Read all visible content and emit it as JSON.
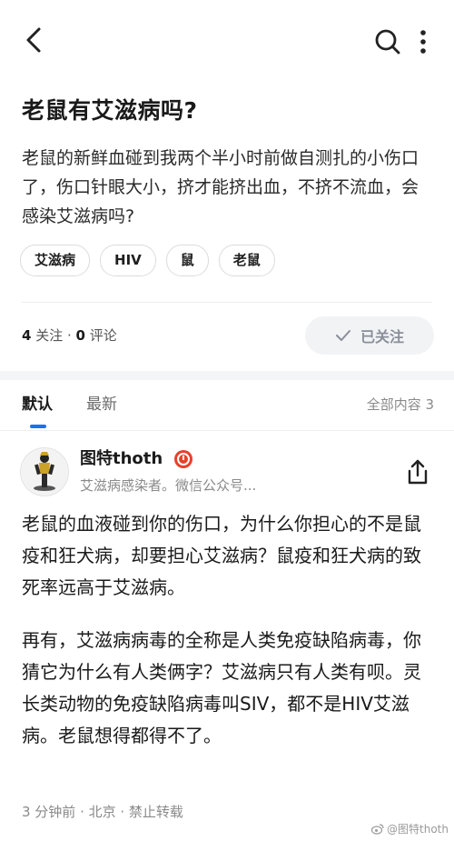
{
  "topbar": {
    "back_icon": "back-arrow-icon",
    "search_icon": "search-icon",
    "more_icon": "more-vertical-icon"
  },
  "question": {
    "title": "老鼠有艾滋病吗?",
    "description": "老鼠的新鲜血碰到我两个半小时前做自测扎的小伤口了，伤口针眼大小，挤才能挤出血，不挤不流血，会感染艾滋病吗?",
    "tags": [
      "艾滋病",
      "HIV",
      "鼠",
      "老鼠"
    ]
  },
  "stats": {
    "follow_count": "4",
    "follow_label": " 关注 · ",
    "comment_count": "0",
    "comment_label": " 评论"
  },
  "follow_button": {
    "label": "已关注",
    "icon": "check-icon"
  },
  "tabs": {
    "default": "默认",
    "latest": "最新",
    "all_count": "全部内容 3"
  },
  "answer": {
    "author_name": "图特thoth",
    "author_bio": "艾滋病感染者。微信公众号...",
    "paragraphs": [
      "老鼠的血液碰到你的伤口，为什么你担心的不是鼠疫和狂犬病，却要担心艾滋病？鼠疫和狂犬病的致死率远高于艾滋病。",
      "再有，艾滋病病毒的全称是人类免疫缺陷病毒，你猜它为什么有人类俩字？艾滋病只有人类有呗。灵长类动物的免疫缺陷病毒叫SIV，都不是HIV艾滋病。老鼠想得都得不了。"
    ],
    "meta": "3 分钟前 · 北京 · 禁止转载"
  },
  "watermark": "@图特thoth",
  "colors": {
    "accent": "#1772f6",
    "badge": "#e8402c"
  }
}
